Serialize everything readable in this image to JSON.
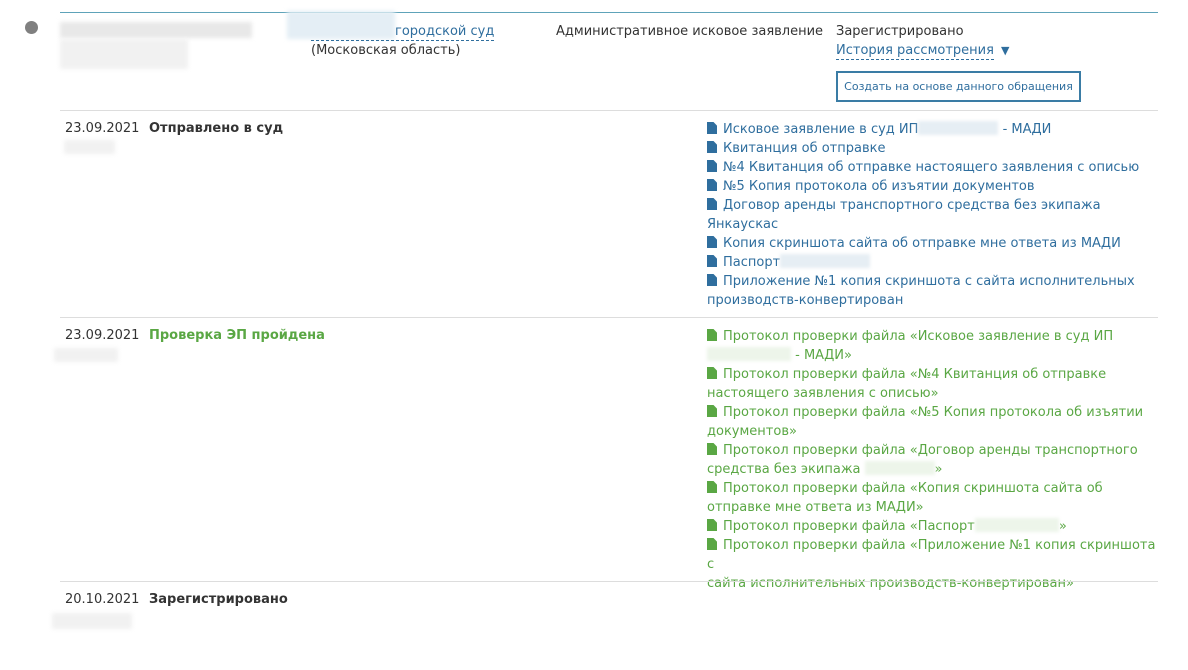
{
  "case": {
    "court_name": "городской суд",
    "court_region": "(Московская область)",
    "case_type": "Административное исковое заявление",
    "status": "Зарегистрировано",
    "history_link": "История рассмотрения",
    "history_arrow": "▼",
    "create_button": "Создать на основе данного обращения"
  },
  "events": [
    {
      "date": "23.09.2021",
      "status": "Отправлено в суд",
      "docs": [
        {
          "pre": "Исковое заявление в суд ИП",
          "post": " - МАДИ"
        },
        {
          "pre": "Квитанция об отправке",
          "post": ""
        },
        {
          "pre": "№4 Квитанция об отправке настоящего заявления с описью",
          "post": ""
        },
        {
          "pre": "№5 Копия протокола об изъятии документов",
          "post": ""
        },
        {
          "pre": "Договор аренды транспортного средства без экипажа",
          "line2": "Янкаускас"
        },
        {
          "pre": "Копия скриншота сайта об отправке мне ответа из МАДИ",
          "post": ""
        },
        {
          "pre": "Паспорт",
          "post": ""
        },
        {
          "pre": "Приложение №1 копия скриншота с сайта исполнительных",
          "line2": "производств-конвертирован"
        }
      ]
    },
    {
      "date": "23.09.2021",
      "status": "Проверка ЭП пройдена",
      "docs": [
        {
          "pre": "Протокол проверки файла «Исковое заявление в суд ИП",
          "line2post": " - МАДИ»"
        },
        {
          "pre": "Протокол проверки файла «№4 Квитанция об отправке",
          "line2": "настоящего заявления с описью»"
        },
        {
          "pre": "Протокол проверки файла «№5 Копия протокола об изъятии",
          "line2": "документов»"
        },
        {
          "pre": "Протокол проверки файла «Договор аренды транспортного",
          "line2": "средства без экипажа",
          "line2end": "»"
        },
        {
          "pre": "Протокол проверки файла «Копия скриншота сайта об",
          "line2": "отправке мне ответа из МАДИ»"
        },
        {
          "pre": "Протокол проверки файла «Паспорт",
          "post": "»"
        },
        {
          "pre": "Протокол проверки файла «Приложение №1 копия скриншота с",
          "line2": "сайта исполнительных производств-конвертирован»"
        }
      ]
    },
    {
      "date": "20.10.2021",
      "status": "Зарегистрировано",
      "docs": []
    }
  ],
  "colors": {
    "link": "#2f6e9e",
    "success": "#5aa744",
    "accent_line": "#5ea3b9",
    "divider": "#dddddd",
    "bullet": "#808080"
  },
  "icons": {
    "bullet": "status-bullet-icon",
    "document": "file-icon"
  }
}
